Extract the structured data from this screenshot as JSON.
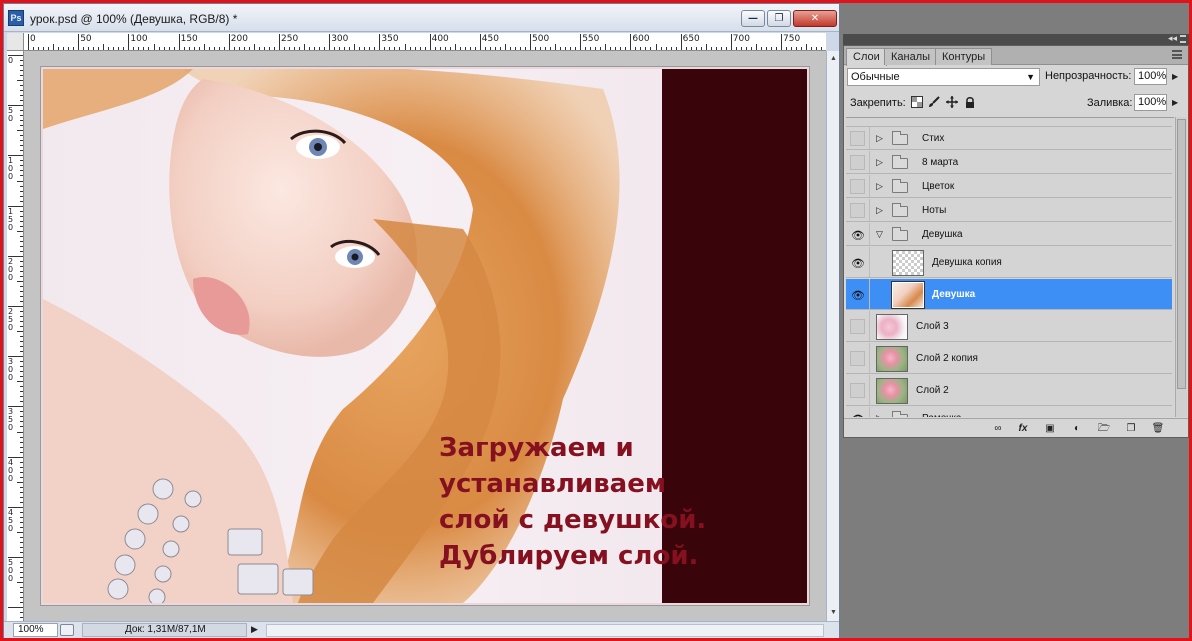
{
  "document": {
    "app_icon": "Ps",
    "title": "урок.psd @ 100% (Девушка, RGB/8) *",
    "window_buttons": {
      "minimize": "minimize-icon",
      "restore": "restore-icon",
      "close": "close-icon"
    },
    "ruler_top_labels": [
      "0",
      "50",
      "100",
      "150",
      "200",
      "250",
      "300",
      "350",
      "400",
      "450",
      "500",
      "550",
      "600",
      "650",
      "700",
      "750"
    ],
    "ruler_left_labels": [
      "0",
      "5 0",
      "1 0 0",
      "1 5 0",
      "2 0 0",
      "2 5 0",
      "3 0 0",
      "3 5 0",
      "4 0 0",
      "4 5 0",
      "5 0 0"
    ],
    "canvas_text_lines": [
      "Загружаем и",
      "устанавливаем",
      "слой с девушкой.",
      "Дублируем слой."
    ],
    "canvas_text_color": "#85101f",
    "right_band_color": "#3a050a",
    "status": {
      "zoom": "100%",
      "doc_info": "Док: 1,31M/87,1M"
    }
  },
  "layers_panel": {
    "tabs": [
      {
        "label": "Слои",
        "active": true
      },
      {
        "label": "Каналы",
        "active": false
      },
      {
        "label": "Контуры",
        "active": false
      }
    ],
    "blend_mode": "Обычные",
    "opacity_label": "Непрозрачность:",
    "opacity_value": "100%",
    "lock_label": "Закрепить:",
    "lock_icons": [
      "lock-transparent-icon",
      "brush-icon",
      "move-icon",
      "padlock-icon"
    ],
    "fill_label": "Заливка:",
    "fill_value": "100%",
    "layers": [
      {
        "name": "Стих",
        "type": "group",
        "visible": false,
        "expanded": false,
        "indent": 0,
        "selected": false
      },
      {
        "name": "8 марта",
        "type": "group",
        "visible": false,
        "expanded": false,
        "indent": 0,
        "selected": false
      },
      {
        "name": "Цветок",
        "type": "group",
        "visible": false,
        "expanded": false,
        "indent": 0,
        "selected": false
      },
      {
        "name": "Ноты",
        "type": "group",
        "visible": false,
        "expanded": false,
        "indent": 0,
        "selected": false
      },
      {
        "name": "Девушка",
        "type": "group",
        "visible": true,
        "expanded": true,
        "indent": 0,
        "selected": false
      },
      {
        "name": "Девушка копия",
        "type": "layer",
        "thumbnail": "transparent",
        "visible": true,
        "indent": 1,
        "selected": false
      },
      {
        "name": "Девушка",
        "type": "layer",
        "thumbnail": "girl",
        "visible": true,
        "indent": 1,
        "selected": true
      },
      {
        "name": "Слой 3",
        "type": "layer",
        "thumbnail": "flowers-light",
        "visible": false,
        "indent": 0,
        "selected": false
      },
      {
        "name": "Слой 2 копия",
        "type": "layer",
        "thumbnail": "flowers",
        "visible": false,
        "indent": 0,
        "selected": false
      },
      {
        "name": "Слой 2",
        "type": "layer",
        "thumbnail": "flowers",
        "visible": false,
        "indent": 0,
        "selected": false
      },
      {
        "name": "Рамочка",
        "type": "group",
        "visible": true,
        "expanded": false,
        "indent": 0,
        "selected": false
      }
    ],
    "footer_icons": [
      "link-layers-icon",
      "fx-icon",
      "layer-mask-icon",
      "adjustment-layer-icon",
      "new-group-icon",
      "new-layer-icon",
      "trash-icon"
    ],
    "selection_color": "#3d8ff5"
  }
}
